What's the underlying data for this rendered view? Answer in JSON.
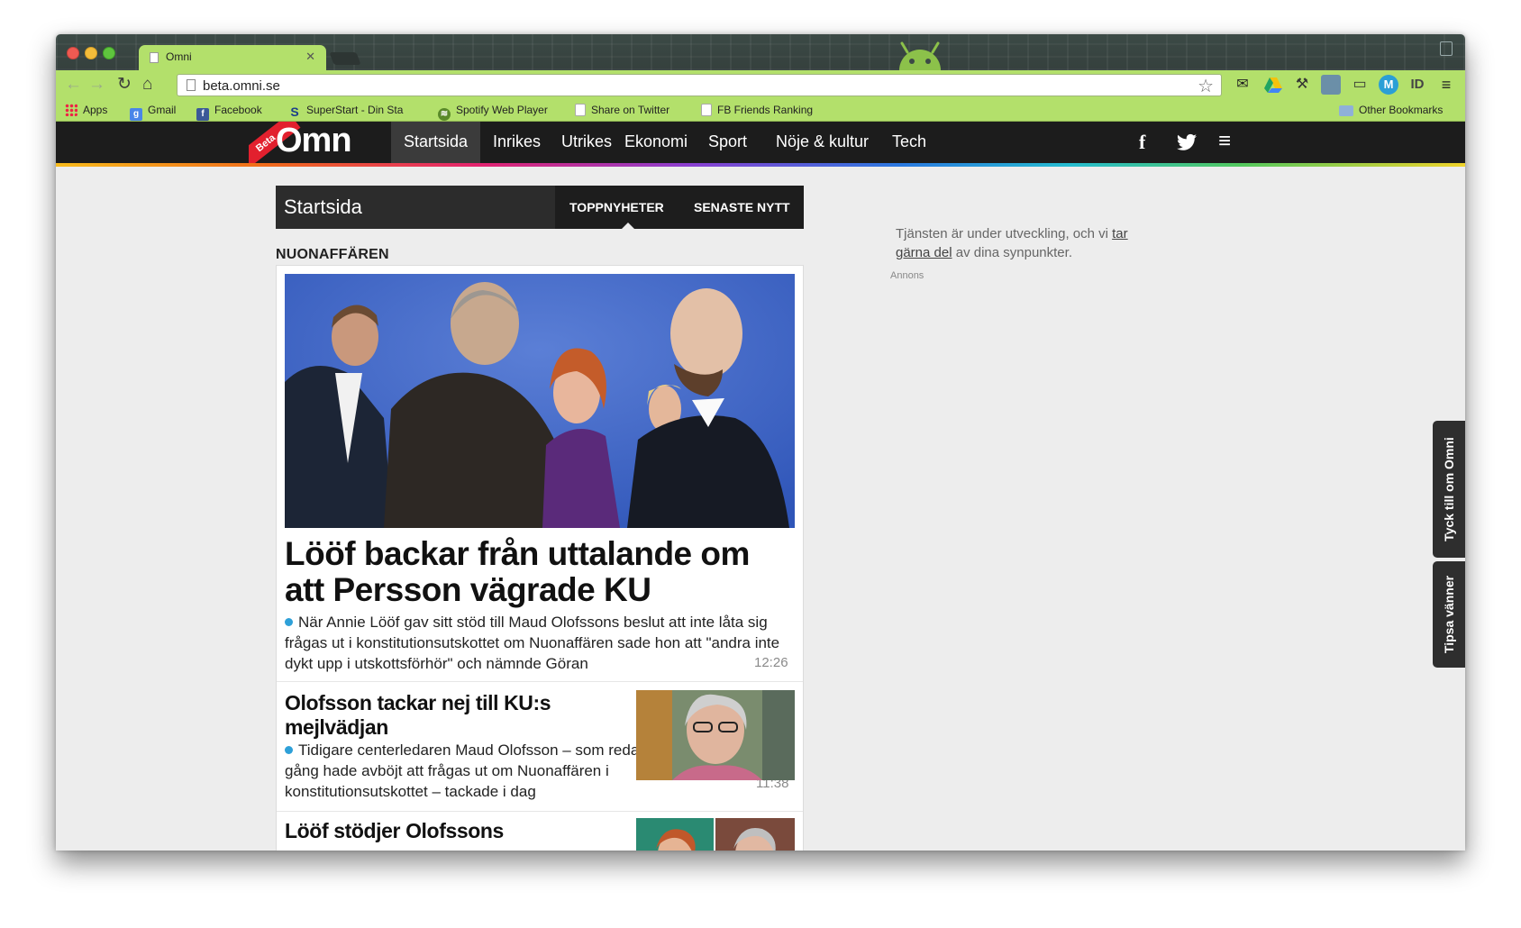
{
  "browser": {
    "tab_title": "Omni",
    "url": "beta.omni.se",
    "bookmarks": [
      {
        "label": "Apps",
        "icon": "apps-grid-icon"
      },
      {
        "label": "Gmail",
        "icon": "google-icon"
      },
      {
        "label": "Facebook",
        "icon": "facebook-icon"
      },
      {
        "label": "SuperStart - Din Sta",
        "icon": "superstart-icon"
      },
      {
        "label": "Spotify Web Player",
        "icon": "spotify-icon"
      },
      {
        "label": "Share on Twitter",
        "icon": "page-icon"
      },
      {
        "label": "FB Friends Ranking",
        "icon": "page-icon"
      }
    ],
    "other_bookmarks": "Other Bookmarks",
    "accent": "#b3e06b"
  },
  "site": {
    "logo_badge": "Beta",
    "logo_word": "Omni",
    "nav": [
      "Startsida",
      "Inrikes",
      "Utrikes",
      "Ekonomi",
      "Sport",
      "Nöje & kultur",
      "Tech"
    ],
    "active_nav": "Startsida",
    "brand_red": "#e2202e"
  },
  "section": {
    "title": "Startsida",
    "tabs": [
      "TOPPNYHETER",
      "SENASTE NYTT"
    ],
    "active_tab": "TOPPNYHETER"
  },
  "topic": "NUONAFFÄREN",
  "articles": [
    {
      "headline": "Lööf backar från uttalande om att Persson vägrade KU",
      "lede": "När Annie Lööf gav sitt stöd till Maud Olofssons beslut att inte låta sig frågas ut i konstitutionsutskottet om Nuonaffären sade hon att \"andra inte dykt upp i utskottsförhör\" och nämnde Göran",
      "time": "12:26"
    },
    {
      "headline": "Olofsson tackar nej till KU:s mejlvädjan",
      "lede": "Tidigare centerledaren Maud Olofsson – som redan en gång hade avböjt att frågas ut om Nuonaffären i konstitutionsutskottet – tackade i dag",
      "time": "11:38"
    },
    {
      "headline": "Lööf stödjer Olofssons",
      "lede": "",
      "time": ""
    }
  ],
  "notice": {
    "text_before": "Tjänsten är under utveckling, och vi ",
    "link": "tar gärna del",
    "text_after": " av dina synpunkter."
  },
  "ad_label": "Annons",
  "side_tabs": [
    "Tyck till om Omni",
    "Tipsa vänner"
  ]
}
